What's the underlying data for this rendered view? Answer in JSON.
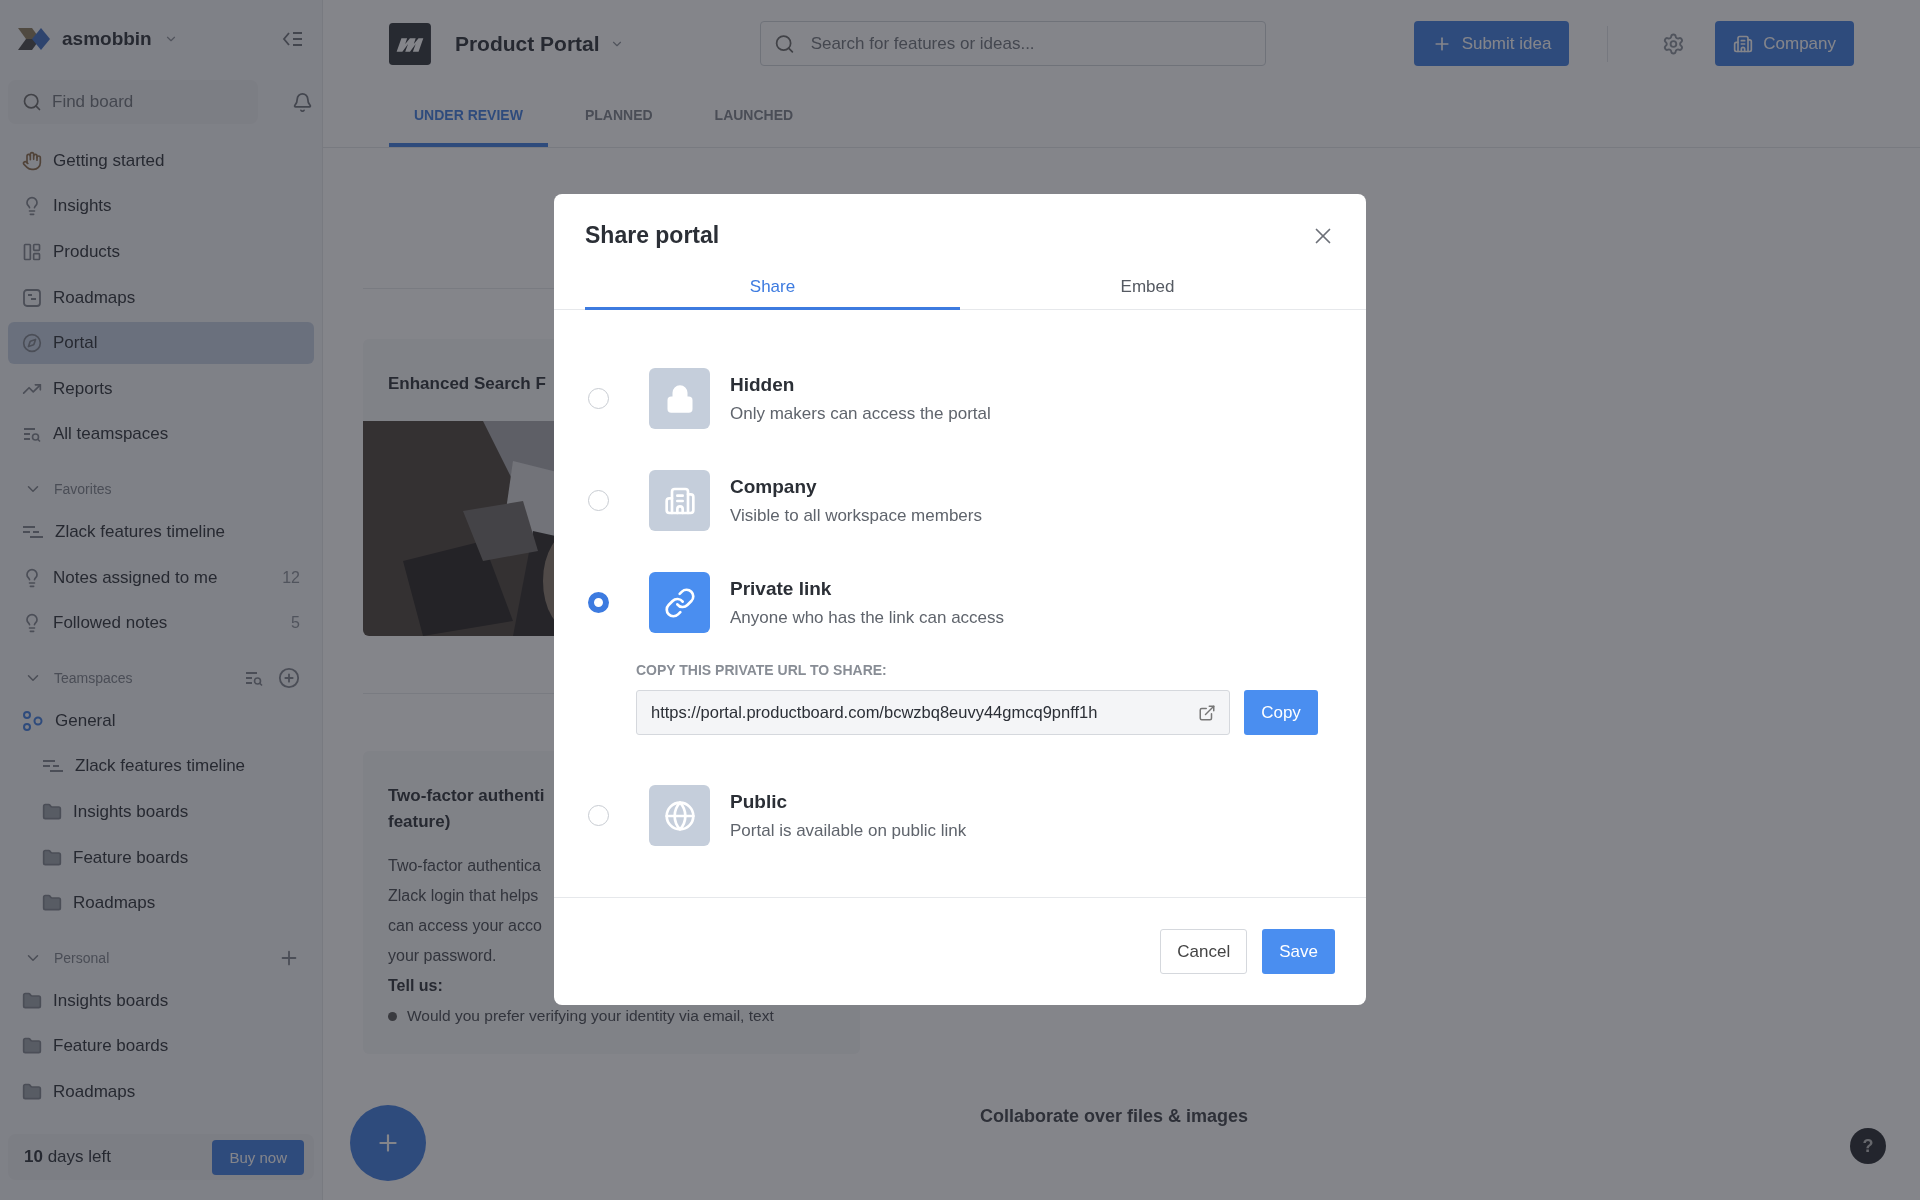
{
  "sidebar": {
    "workspace": "asmobbin",
    "search": {
      "placeholder": "Find board"
    },
    "nav": [
      {
        "label": "Getting started",
        "kind": "wave",
        "selected": false
      },
      {
        "label": "Insights",
        "kind": "insight",
        "selected": false
      },
      {
        "label": "Products",
        "kind": "product",
        "selected": false
      },
      {
        "label": "Roadmaps",
        "kind": "roadmap",
        "selected": false
      },
      {
        "label": "Portal",
        "kind": "portal",
        "selected": true
      },
      {
        "label": "Reports",
        "kind": "report",
        "selected": false
      },
      {
        "label": "All teamspaces",
        "kind": "teamspaces",
        "selected": false
      }
    ],
    "sections": [
      {
        "title": "Favorites",
        "kind": "favorites",
        "expanded": true,
        "items": [
          {
            "label": "Zlack features timeline",
            "kind": "timeline"
          },
          {
            "label": "Notes assigned to me",
            "kind": "insight",
            "count": "12"
          },
          {
            "label": "Followed notes",
            "kind": "insight",
            "count": "5"
          }
        ]
      },
      {
        "title": "Teamspaces",
        "kind": "teamspaces",
        "expanded": true,
        "items": [
          {
            "label": "General",
            "kind": "team",
            "children": [
              {
                "label": "Zlack features timeline",
                "kind": "timeline"
              },
              {
                "label": "Insights boards",
                "kind": "folder"
              },
              {
                "label": "Feature boards",
                "kind": "folder"
              },
              {
                "label": "Roadmaps",
                "kind": "folder"
              }
            ]
          }
        ]
      },
      {
        "title": "Personal",
        "kind": "personal",
        "expanded": true,
        "items": [
          {
            "label": "Insights boards",
            "kind": "folder"
          },
          {
            "label": "Feature boards",
            "kind": "folder"
          },
          {
            "label": "Roadmaps",
            "kind": "folder"
          }
        ]
      }
    ],
    "trial": {
      "days": "10",
      "text": "days left",
      "button": "Buy now"
    }
  },
  "header": {
    "product": "Product Portal",
    "search": {
      "placeholder": "Search for features or ideas..."
    },
    "submit": "Submit idea",
    "visibility": "Company"
  },
  "tabs": [
    {
      "label": "UNDER REVIEW",
      "selected": true
    },
    {
      "label": "PLANNED",
      "selected": false
    },
    {
      "label": "LAUNCHED",
      "selected": false
    }
  ],
  "cards": [
    {
      "title": "Enhanced Search F"
    },
    {
      "kind": "text",
      "title_lines": [
        "Two-factor authenti",
        "feature)"
      ],
      "body": [
        "Two-factor authentica",
        "Zlack login that helps",
        "can access your acco",
        "your password."
      ],
      "subhead": "Tell us:",
      "bullets": [
        "Would you prefer verifying your identity via email, text"
      ]
    }
  ],
  "collaborate": "Collaborate over files & images",
  "help": "?",
  "modal": {
    "title": "Share portal",
    "tabs": [
      {
        "label": "Share",
        "selected": true
      },
      {
        "label": "Embed",
        "selected": false
      }
    ],
    "options": [
      {
        "kind": "hidden",
        "title": "Hidden",
        "description": "Only makers can access the portal",
        "selected": false
      },
      {
        "kind": "company",
        "title": "Company",
        "description": "Visible to all workspace members",
        "selected": false
      },
      {
        "kind": "link",
        "title": "Private link",
        "description": "Anyone who has the link can access",
        "selected": true
      },
      {
        "kind": "public",
        "title": "Public",
        "description": "Portal is available on public link",
        "selected": false
      }
    ],
    "url_label": "COPY THIS PRIVATE URL TO SHARE:",
    "url": "https://portal.productboard.com/bcwzbq8euvy44gmcq9pnff1h",
    "copy": "Copy",
    "cancel": "Cancel",
    "save": "Save"
  }
}
